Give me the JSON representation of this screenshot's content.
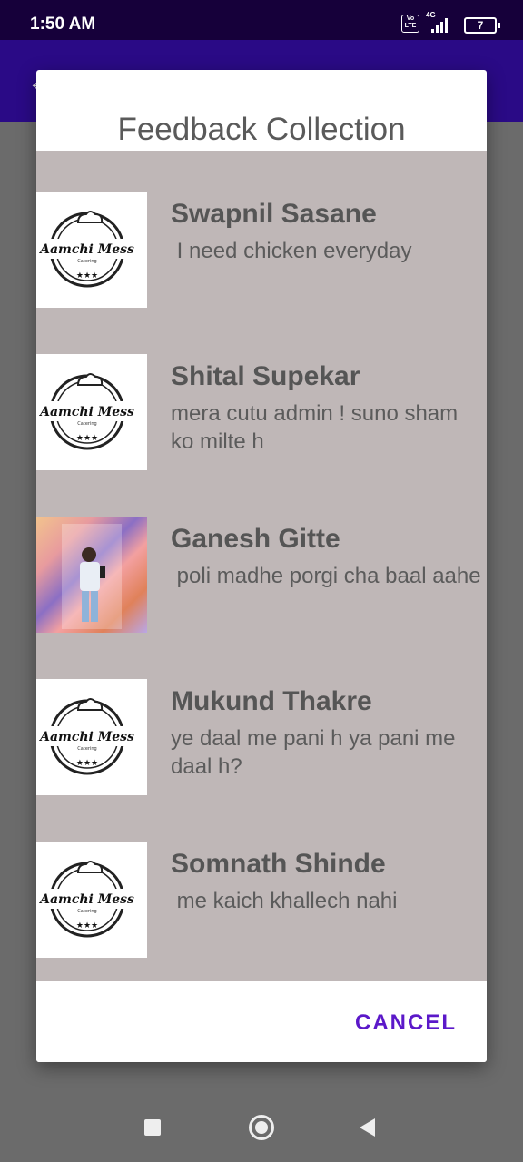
{
  "status_bar": {
    "time": "1:50 AM",
    "volte_label": "Vo LTE",
    "network": "4G",
    "battery": "7"
  },
  "app_bar": {
    "back_icon": "arrow-back-icon"
  },
  "dialog": {
    "title": "Feedback Collection",
    "cancel_label": "CANCEL",
    "items": [
      {
        "name": "Swapnil Sasane",
        "message": " I need chicken everyday",
        "avatar": "aamchi-mess-logo"
      },
      {
        "name": "Shital Supekar",
        "message": "mera cutu admin ! suno sham ko milte h",
        "avatar": "aamchi-mess-logo"
      },
      {
        "name": "Ganesh Gitte",
        "message": " poli madhe porgi cha baal aahe",
        "avatar": "user-photo"
      },
      {
        "name": "Mukund Thakre",
        "message": "ye daal me pani h ya pani me daal h?",
        "avatar": "aamchi-mess-logo"
      },
      {
        "name": "Somnath Shinde",
        "message": " me kaich khallech nahi",
        "avatar": "aamchi-mess-logo"
      }
    ],
    "logo_text": "Aamchi Mess",
    "logo_subtext": "Catering"
  },
  "nav_bar": {
    "recent_icon": "square-recent-icon",
    "home_icon": "circle-home-icon",
    "back_icon": "triangle-back-icon"
  },
  "colors": {
    "status_bar": "#16003a",
    "app_bar": "#2a0a86",
    "list_background": "#bfb7b7",
    "accent": "#5b18c9"
  }
}
